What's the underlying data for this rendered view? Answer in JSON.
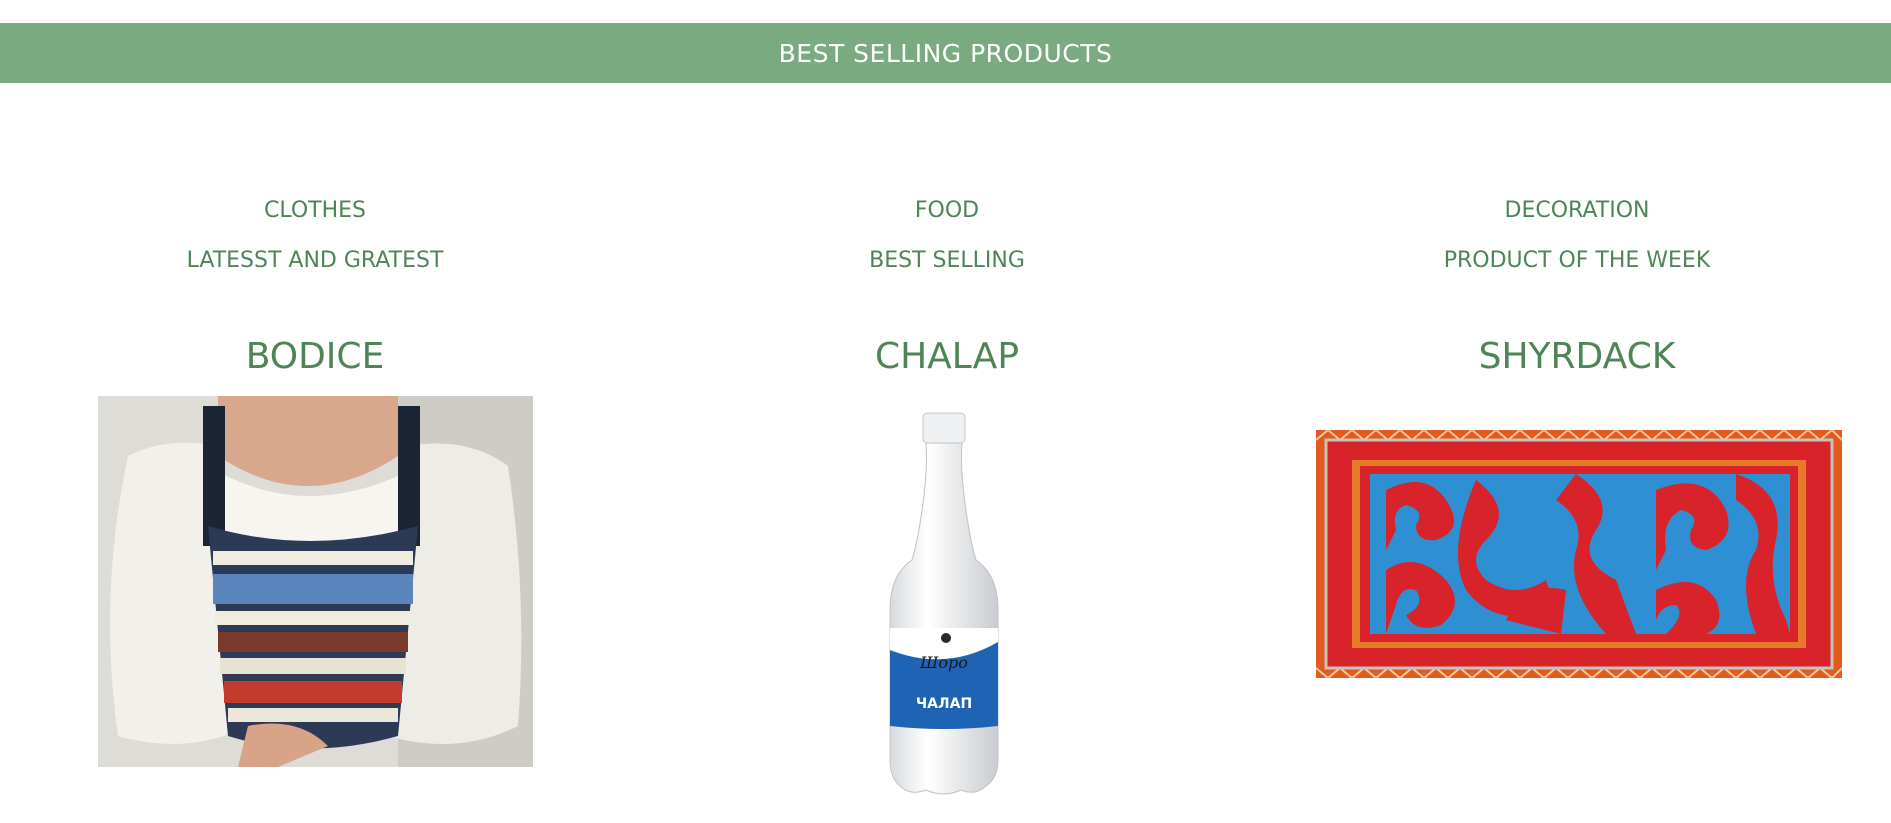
{
  "banner": {
    "title": "BEST SELLING PRODUCTS",
    "color": "#7aab80"
  },
  "accent_color": "#4e8457",
  "products": [
    {
      "category": "CLOTHES",
      "tagline": "LATESST AND GRATEST",
      "name": "BODICE",
      "image": "bodice-photo"
    },
    {
      "category": "FOOD",
      "tagline": "BEST SELLING",
      "name": "CHALAP",
      "image": "chalap-bottle-photo",
      "label_brand": "Шоро",
      "label_text": "ЧАЛАП"
    },
    {
      "category": "DECORATION",
      "tagline": "PRODUCT OF THE WEEK",
      "name": "SHYRDACK",
      "image": "shyrdak-rug-photo"
    }
  ]
}
